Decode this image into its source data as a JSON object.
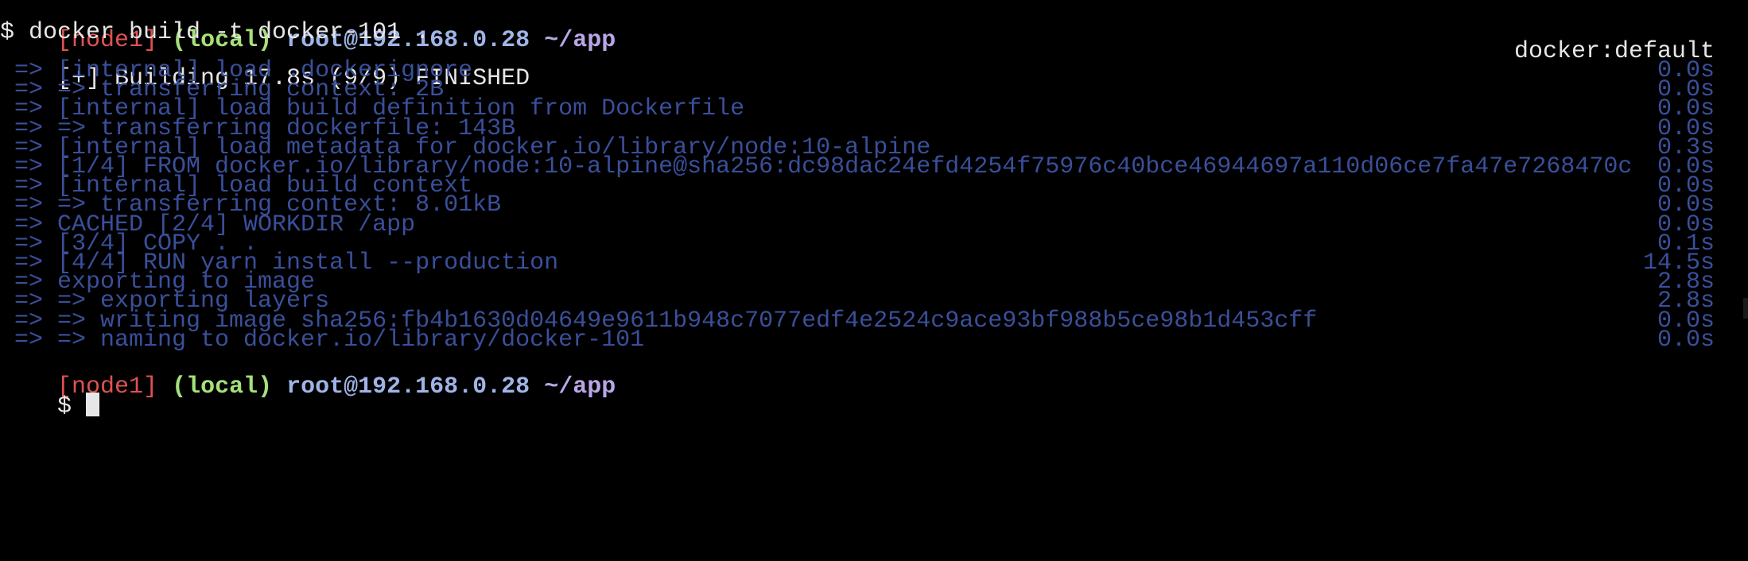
{
  "colors": {
    "background": "#000000",
    "node": "#e05252",
    "local": "#a6e07a",
    "user": "#9fb4e6",
    "dir": "#b9a6e6",
    "step": "#3a4f9a",
    "plain": "#e6e6e6"
  },
  "prompt1": {
    "node": "[node1]",
    "local": "(local)",
    "user": "root@192.168.0.28",
    "dir": "~/app"
  },
  "command": "$ docker build -t docker-101 .",
  "build": {
    "status": "[+] Building 17.8s (9/9) FINISHED",
    "builder": "docker:default"
  },
  "steps": [
    {
      "text": " => [internal] load .dockerignore",
      "time": "0.0s"
    },
    {
      "text": " => => transferring context: 2B",
      "time": "0.0s"
    },
    {
      "text": " => [internal] load build definition from Dockerfile",
      "time": "0.0s"
    },
    {
      "text": " => => transferring dockerfile: 143B",
      "time": "0.0s"
    },
    {
      "text": " => [internal] load metadata for docker.io/library/node:10-alpine",
      "time": "0.3s"
    },
    {
      "text": " => [1/4] FROM docker.io/library/node:10-alpine@sha256:dc98dac24efd4254f75976c40bce46944697a110d06ce7fa47e7268470c",
      "time": "0.0s"
    },
    {
      "text": " => [internal] load build context",
      "time": "0.0s"
    },
    {
      "text": " => => transferring context: 8.01kB",
      "time": "0.0s"
    },
    {
      "text": " => CACHED [2/4] WORKDIR /app",
      "time": "0.0s"
    },
    {
      "text": " => [3/4] COPY . .",
      "time": "0.1s"
    },
    {
      "text": " => [4/4] RUN yarn install --production",
      "time": "14.5s"
    },
    {
      "text": " => exporting to image",
      "time": "2.8s"
    },
    {
      "text": " => => exporting layers",
      "time": "2.8s"
    },
    {
      "text": " => => writing image sha256:fb4b1630d04649e9611b948c7077edf4e2524c9ace93bf988b5ce98b1d453cff",
      "time": "0.0s"
    },
    {
      "text": " => => naming to docker.io/library/docker-101",
      "time": "0.0s"
    }
  ],
  "prompt2": {
    "node": "[node1]",
    "local": "(local)",
    "user": "root@192.168.0.28",
    "dir": "~/app"
  },
  "input_line": {
    "symbol": "$ ",
    "value": ""
  }
}
